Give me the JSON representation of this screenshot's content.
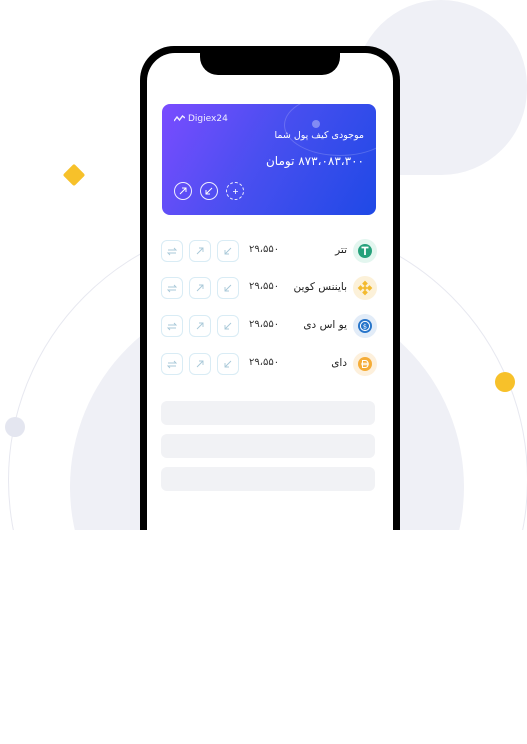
{
  "brand": {
    "name": "Digiex24"
  },
  "wallet": {
    "title": "موجودی کیف پول شما",
    "amount": "۸۷۳،۰۸۳،۳۰۰ تومان",
    "actions": [
      "withdraw-icon",
      "deposit-icon",
      "add-icon"
    ]
  },
  "assets": [
    {
      "name": "تتر",
      "price": "۲۹،۵۵۰",
      "icon": "tether-icon",
      "color": "#26a17b",
      "bg": "#e3f6ef"
    },
    {
      "name": "بایننس کوین",
      "price": "۲۹،۵۵۰",
      "icon": "binance-coin-icon",
      "color": "#f3ba2f",
      "bg": "#fcf1d9"
    },
    {
      "name": "یو اس دی",
      "price": "۲۹،۵۵۰",
      "icon": "usd-coin-icon",
      "color": "#2775ca",
      "bg": "#e2ecf8"
    },
    {
      "name": "دای",
      "price": "۲۹،۵۵۰",
      "icon": "dai-icon",
      "color": "#f5ac37",
      "bg": "#fdf0dc"
    }
  ],
  "colors": {
    "accent": "#f7c12a",
    "card_start": "#7a4cff",
    "card_end": "#1f49e6",
    "background_shape": "#eff0f6"
  }
}
